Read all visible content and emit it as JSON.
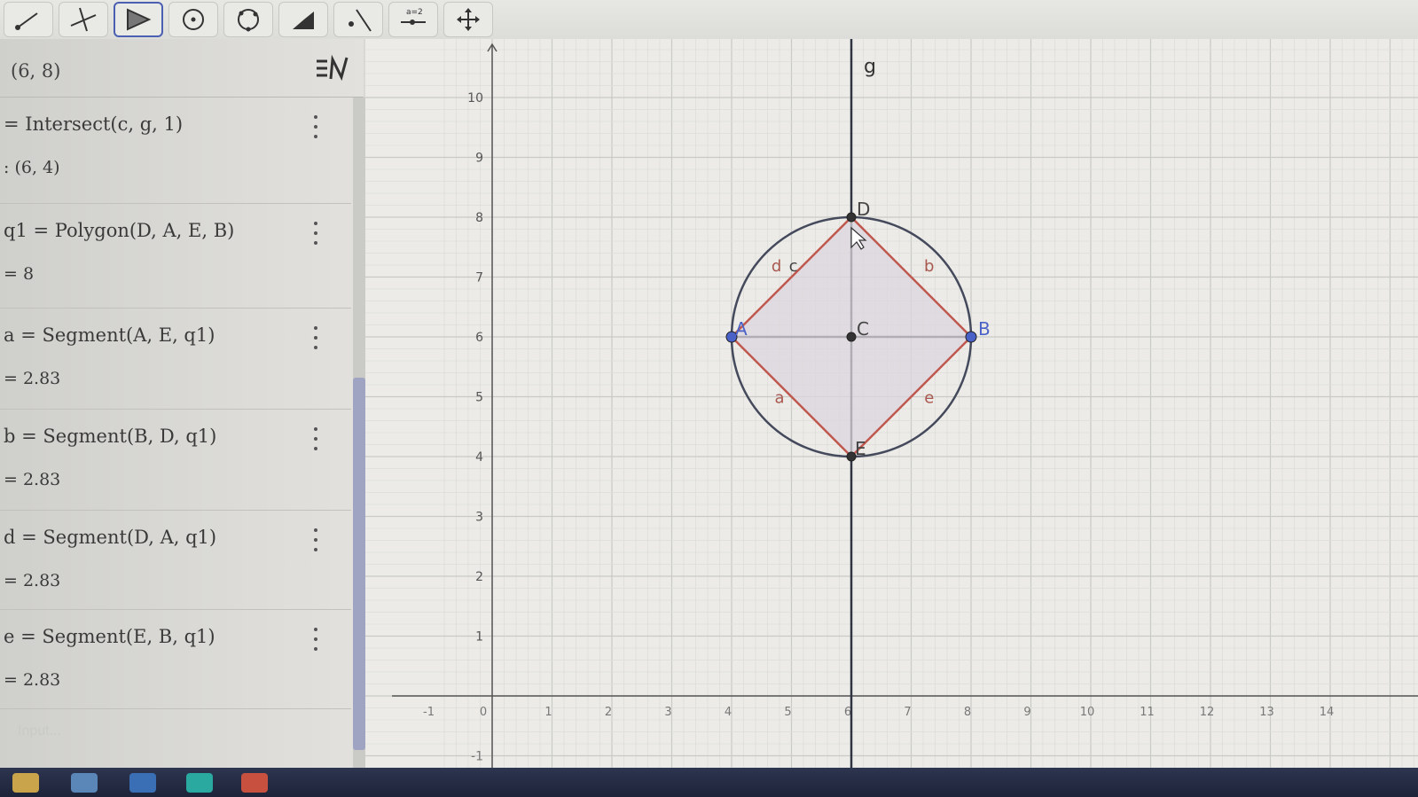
{
  "toolbar": {
    "tools": [
      {
        "name": "move-tool-icon"
      },
      {
        "name": "point-tool-icon"
      },
      {
        "name": "polygon-tool-icon",
        "active": true
      },
      {
        "name": "circle-center-tool-icon"
      },
      {
        "name": "circle-three-points-tool-icon"
      },
      {
        "name": "angle-tool-icon"
      },
      {
        "name": "reflect-tool-icon"
      },
      {
        "name": "slider-tool-icon",
        "label": "a=2"
      },
      {
        "name": "move-graphics-view-tool-icon"
      }
    ]
  },
  "algebra": {
    "input_value": "(6, 8)",
    "entries": [
      {
        "definition": "= Intersect(c, g, 1)",
        "result": ": (6, 4)"
      },
      {
        "definition": "q1 = Polygon(D, A, E, B)",
        "result": "= 8"
      },
      {
        "definition": "a = Segment(A, E, q1)",
        "result": "= 2.83"
      },
      {
        "definition": "b = Segment(B, D, q1)",
        "result": "= 2.83"
      },
      {
        "definition": "d = Segment(D, A, q1)",
        "result": "= 2.83"
      },
      {
        "definition": "e = Segment(E, B, q1)",
        "result": "= 2.83"
      }
    ],
    "input_placeholder": "Input..."
  },
  "graphics": {
    "x_ticks": [
      "-1",
      "0",
      "1",
      "2",
      "3",
      "4",
      "5",
      "6",
      "7",
      "8",
      "9",
      "10",
      "11",
      "12",
      "13",
      "14"
    ],
    "y_ticks": [
      "1",
      "2",
      "3",
      "4",
      "5",
      "6",
      "7",
      "8",
      "9",
      "10"
    ],
    "y_negative_tick": "-1",
    "line_label": "g",
    "points": [
      {
        "label": "A",
        "x": 4,
        "y": 6
      },
      {
        "label": "B",
        "x": 8,
        "y": 6
      },
      {
        "label": "C",
        "x": 6,
        "y": 6
      },
      {
        "label": "D",
        "x": 6,
        "y": 8
      },
      {
        "label": "E",
        "x": 6,
        "y": 4
      }
    ],
    "segment_labels": [
      "a",
      "b",
      "d",
      "e"
    ],
    "circle_label": "c",
    "circle": {
      "center_x": 6,
      "center_y": 6,
      "radius": 2
    },
    "colors": {
      "polygon_edge": "#c0584f",
      "polygon_fill": "#dcd6de",
      "circle": "#444a5c",
      "free_point": "#4a62c8",
      "axis": "#3a3a3a"
    }
  }
}
